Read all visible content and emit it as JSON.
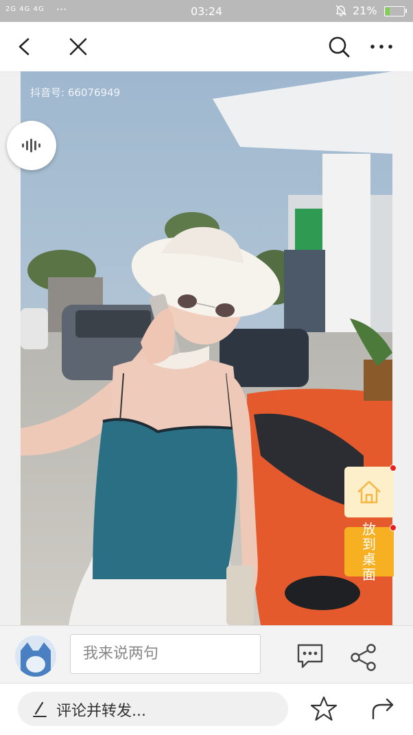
{
  "status_bar": {
    "signal": "2G 4G 4G",
    "more": "···",
    "time": "03:24",
    "battery_percent": "21%",
    "battery_level": 0.21
  },
  "top_bar": {
    "back_icon": "back-icon",
    "close_icon": "close-icon",
    "search_icon": "search-icon",
    "more_icon": "more-icon"
  },
  "video": {
    "watermark": "抖音号: 66076949"
  },
  "floating": {
    "home_icon": "home-icon",
    "desktop_button": "放到桌面"
  },
  "comment_bar": {
    "placeholder": "我来说两句"
  },
  "bottom_bar": {
    "comment_forward": "评论并转发..."
  },
  "colors": {
    "status_bg": "#b9b9b9",
    "desk_btn": "#f7b022",
    "home_btn_bg": "#fdefc9",
    "badge": "#f01d1d"
  }
}
